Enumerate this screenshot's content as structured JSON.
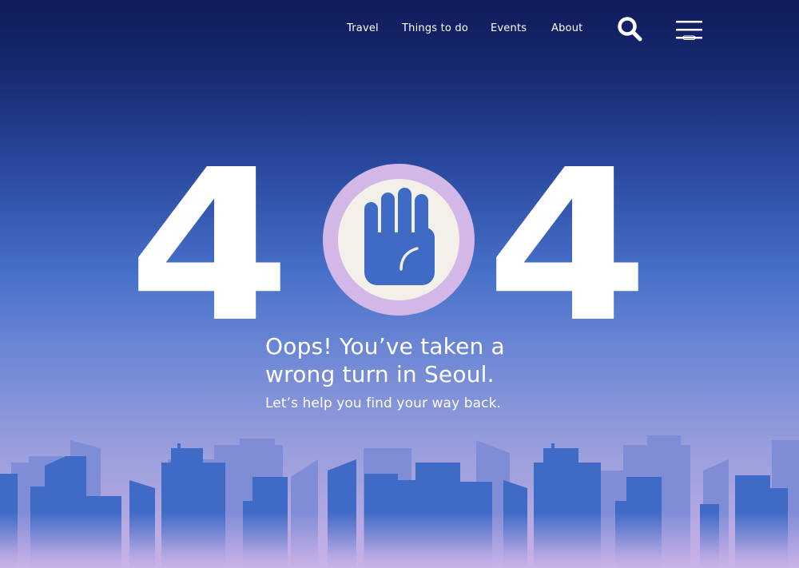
{
  "nav": {
    "links": [
      {
        "label": "Travel"
      },
      {
        "label": "Things to do"
      },
      {
        "label": "Events"
      },
      {
        "label": "About"
      }
    ],
    "search_icon": "search-icon",
    "menu_icon": "hamburger-menu-icon"
  },
  "error": {
    "digit_left": "4",
    "digit_right": "4",
    "badge_icon": "raised-hand-icon"
  },
  "message": {
    "line1": "Oops! You’ve taken a",
    "line2": "wrong turn in Seoul.",
    "subtitle": "Let’s help you find your way back."
  },
  "colors": {
    "top_background": "#0f1b5c",
    "mid_background": "#4770c9",
    "bottom_background": "#c4aee6",
    "badge_ring": "#d3b7e6",
    "badge_inner": "#f3f0ea",
    "hand": "#3f6ac6",
    "building_front": "#3f6ac6",
    "building_back": "#7f8dd6"
  }
}
